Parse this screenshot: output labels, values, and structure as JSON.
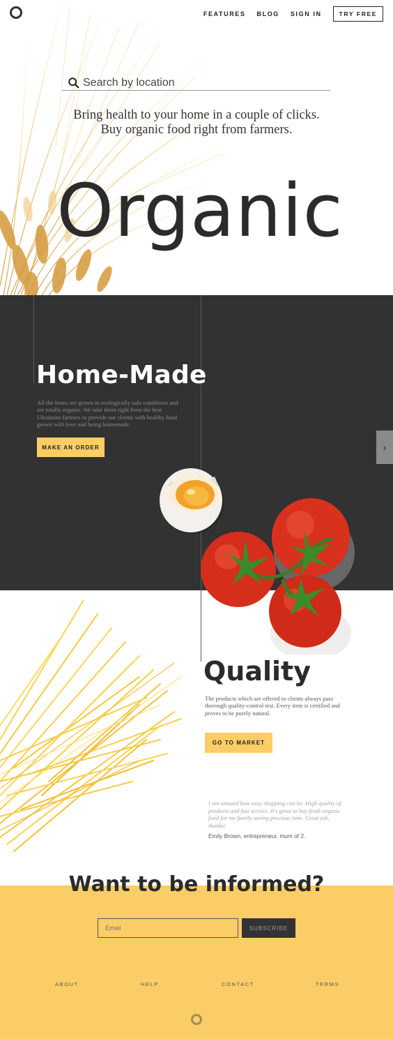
{
  "brand": {
    "logo_icon": "ring-logo-icon"
  },
  "nav": {
    "items": [
      "FEATURES",
      "BLOG",
      "SIGN IN"
    ],
    "cta": "TRY FREE"
  },
  "hero": {
    "search_placeholder": "Search by location",
    "tagline_line1": "Bring health to your home in a couple of clicks.",
    "tagline_line2": "Buy organic food right from farmers.",
    "big_word": "Organic"
  },
  "homemade": {
    "title": "Home-Made",
    "body": "All the items are grown in ecologically safe conditions and are totally organic. We take them right from the best Ukrainian farmers to provide our clients with healthy food grown with love and being homemade.",
    "button": "MAKE AN ORDER",
    "next_icon": "chevron-right-icon"
  },
  "quality": {
    "title": "Quality",
    "body": "The products which are offered to clients always pass thorough quality-control test. Every item is certified and proves to be purely natural.",
    "button": "GO TO MARKET"
  },
  "testimonial": {
    "quote": "I am amazed how easy shopping can be. High quality of products and fast service. It's great to buy fresh organic food for my family saving precious time. Great job, thanks!",
    "author": "Emily Brown, entrepreneur, mum of 2."
  },
  "newsletter": {
    "title": "Want to be informed?",
    "email_placeholder": "Email",
    "button": "SUBSCRIBE"
  },
  "footer": {
    "links": [
      "ABOUT",
      "HELP",
      "CONTACT",
      "TERMS"
    ]
  },
  "colors": {
    "accent_yellow": "#fbcd66",
    "dark_bg": "#323232",
    "text_dark": "#2b2b2b"
  }
}
